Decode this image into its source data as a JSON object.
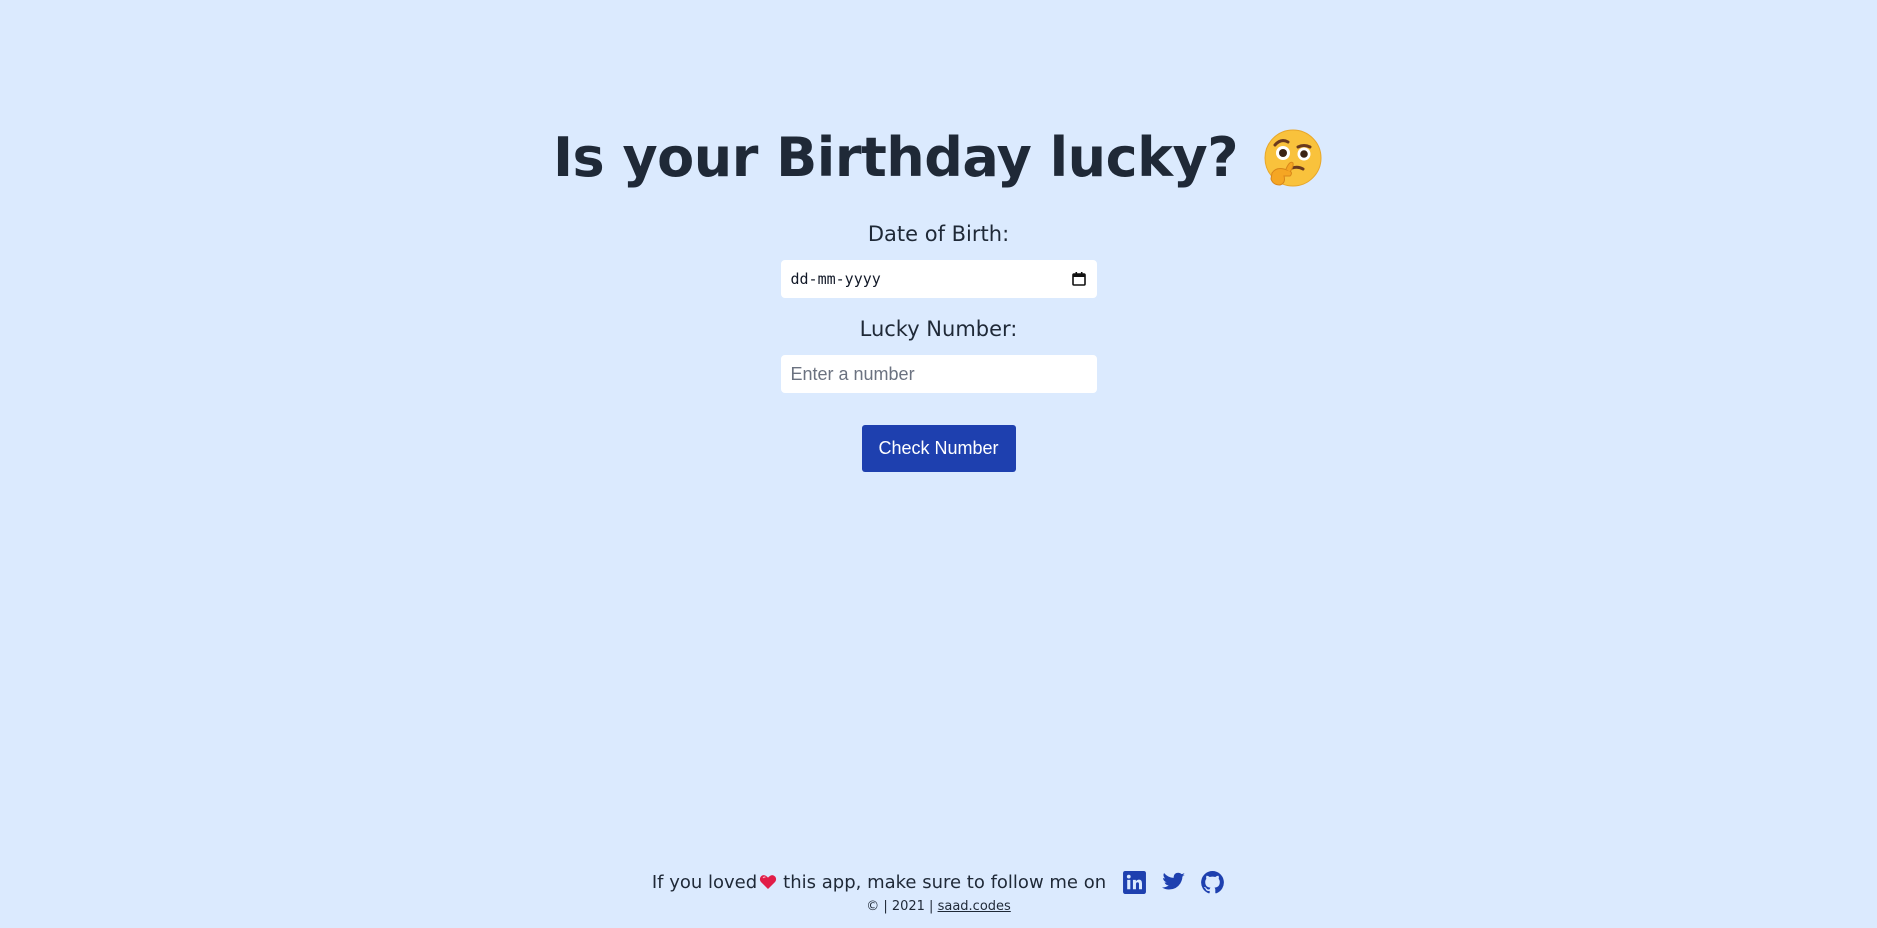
{
  "header": {
    "title": "Is your Birthday lucky?",
    "emoji": "thinking-face-with-raised-eyebrow"
  },
  "form": {
    "dob_label": "Date of Birth:",
    "dob_value": "dd-mm-yyyy",
    "lucky_label": "Lucky Number:",
    "lucky_placeholder": "Enter a number",
    "submit_label": "Check Number"
  },
  "footer": {
    "text_before": "If you loved",
    "text_after": " this app, make sure to follow me on",
    "social": [
      "linkedin-icon",
      "twitter-icon",
      "github-icon"
    ],
    "copyright_prefix": "© | 2021 |",
    "site_link": "saad.codes"
  },
  "colors": {
    "background": "#dbeafe",
    "primary": "#1e40af",
    "text": "#1f2937",
    "heart": "#e11d48"
  }
}
